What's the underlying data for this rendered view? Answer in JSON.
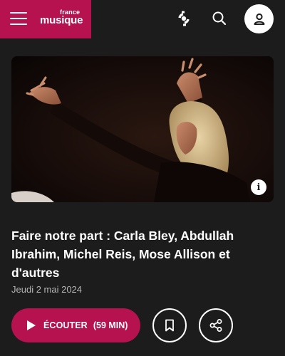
{
  "header": {
    "brand_small": "france",
    "brand_main": "musique",
    "brand_color": "#b5124f",
    "icons": [
      "menu-icon",
      "radio-live-icon",
      "search-icon",
      "account-icon"
    ]
  },
  "hero": {
    "info_glyph": "i"
  },
  "article": {
    "title": "Faire notre part : Carla Bley, Abdullah Ibrahim, Michel Reis, Mose Allison et d'autres",
    "date": "Jeudi 2 mai 2024"
  },
  "actions": {
    "listen_label": "ÉCOUTER",
    "listen_duration": "(59 MIN)",
    "accent": "#b5124f",
    "icons": [
      "play-icon",
      "bookmark-icon",
      "share-icon"
    ]
  }
}
